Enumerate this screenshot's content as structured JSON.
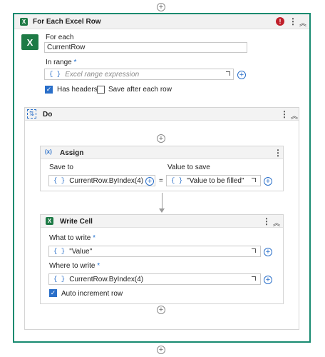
{
  "activity": {
    "title": "For Each Excel Row",
    "for_each_label": "For each",
    "for_each_value": "CurrentRow",
    "in_range_label": "In range",
    "in_range_required": "*",
    "in_range_placeholder": "Excel range expression",
    "has_headers_label": "Has headers",
    "has_headers_checked": true,
    "save_after_label": "Save after each row",
    "save_after_checked": false,
    "error_badge": "!"
  },
  "do_block": {
    "title": "Do"
  },
  "assign": {
    "title": "Assign",
    "save_to_label": "Save to",
    "save_to_value": "CurrentRow.ByIndex(4)",
    "equals": "=",
    "value_label": "Value to save",
    "value_value": "\"Value to be filled\""
  },
  "write_cell": {
    "title": "Write Cell",
    "what_label": "What to write",
    "what_required": "*",
    "what_value": "\"Value\"",
    "where_label": "Where to write",
    "where_required": "*",
    "where_value": "CurrentRow.ByIndex(4)",
    "auto_increment_label": "Auto increment row",
    "auto_increment_checked": true
  },
  "glyphs": {
    "plus": "+",
    "fx": "{ }",
    "kebab": "⋮",
    "collapse": "︽",
    "check": "✓",
    "excel": "X",
    "assign_icon": "(x)"
  },
  "colors": {
    "accent": "#178a70",
    "excel": "#1d7a45",
    "link": "#2a6fc9",
    "error": "#c0202b"
  }
}
